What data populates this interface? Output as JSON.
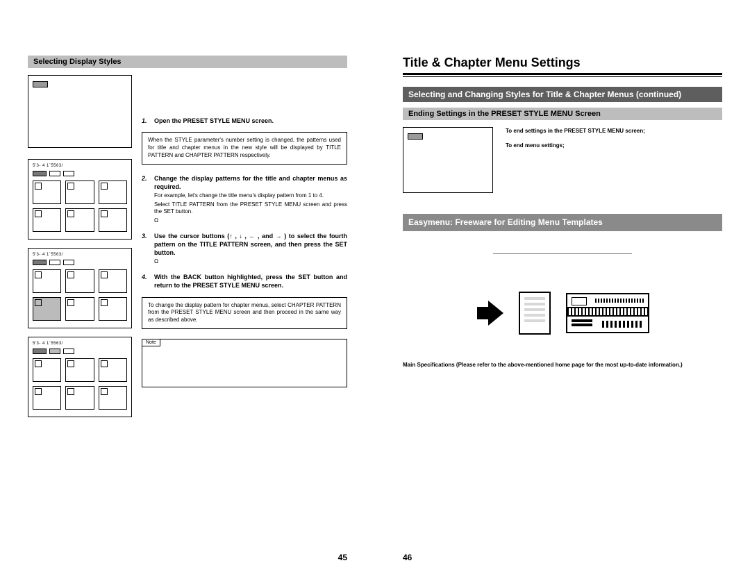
{
  "left": {
    "subheader": "Selecting Display Styles",
    "steps": {
      "s1": "Open the PRESET STYLE MENU screen.",
      "box1": "When the STYLE parameter's number setting is changed, the patterns used for title and chapter menus in the new style will be displayed by TITLE PATTERN and CHAPTER PATTERN respectively.",
      "s2": "Change the display patterns for the title and chapter menus as required.",
      "s2sub1": "For example, let's change the title menu's display pattern from 1 to 4.",
      "s2sub2": "Select TITLE PATTERN from the PRESET STYLE MENU screen and press the SET button.",
      "s3": "Use the cursor buttons (↑ , ↓ , ← , and → ) to select the fourth pattern on the TITLE PATTERN screen, and then press the SET button.",
      "s4": "With the BACK button highlighted, press the SET button and return to the PRESET STYLE MENU screen.",
      "box2": "To change the display pattern for chapter menus, select CHAPTER PATTERN from the PRESET STYLE MENU screen and then proceed in the same way as described above.",
      "note_label": "Note",
      "omega": "Ω"
    },
    "tg_header": "5'3- 4   1`5563/",
    "page_num": "45"
  },
  "right": {
    "title": "Title & Chapter Menu Settings",
    "bar1": "Selecting and Changing Styles for Title & Chapter Menus (continued)",
    "bar2": "Ending Settings in the PRESET STYLE MENU Screen",
    "end1": "To end settings in the PRESET STYLE MENU screen;",
    "end2": "To end menu settings;",
    "bar3": "Easymenu: Freeware for Editing Menu Templates",
    "specs": "Main Specifications (Please refer to the above-mentioned home page for the most up-to-date information.)",
    "page_num": "46"
  }
}
